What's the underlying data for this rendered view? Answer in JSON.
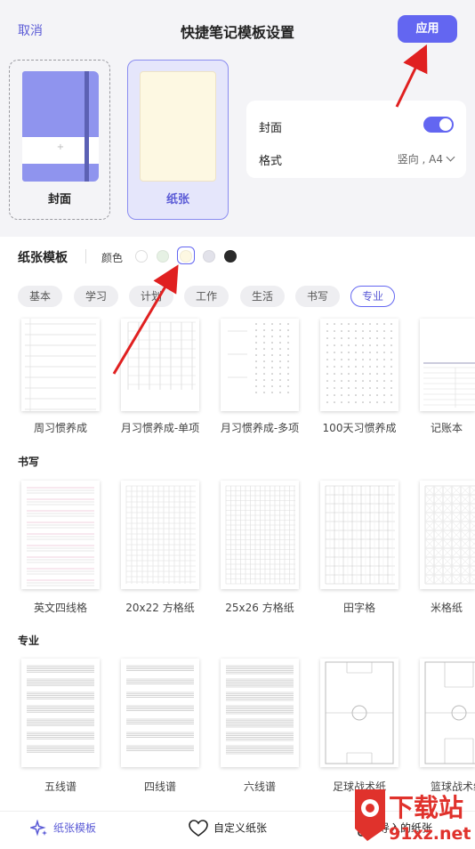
{
  "header": {
    "cancel": "取消",
    "title": "快捷笔记模板设置",
    "apply": "应用"
  },
  "cards": {
    "cover_label": "封面",
    "paper_label": "纸张",
    "cover_plus": "+"
  },
  "settings": {
    "cover_label": "封面",
    "cover_enabled": true,
    "format_label": "格式",
    "format_value": "竖向 , A4"
  },
  "template_bar": {
    "title": "纸张模板",
    "color_label": "颜色"
  },
  "colors": [
    "#ffffff",
    "#e6f1e4",
    "#fdf8e2",
    "#e2e2ea",
    "#2a2a2a"
  ],
  "selected_color_index": 2,
  "accent": "#6366f1",
  "tabs": [
    {
      "label": "基本",
      "active": false
    },
    {
      "label": "学习",
      "active": false
    },
    {
      "label": "计划",
      "active": false
    },
    {
      "label": "工作",
      "active": false
    },
    {
      "label": "生活",
      "active": false
    },
    {
      "label": "书写",
      "active": false
    },
    {
      "label": "专业",
      "active": true
    }
  ],
  "rows": [
    {
      "items": [
        "周习惯养成",
        "月习惯养成-单项",
        "月习惯养成-多项",
        "100天习惯养成",
        "记账本"
      ]
    },
    {
      "title": "书写",
      "items": [
        "英文四线格",
        "20x22 方格纸",
        "25x26 方格纸",
        "田字格",
        "米格纸"
      ]
    },
    {
      "title": "专业",
      "items": [
        "五线谱",
        "四线谱",
        "六线谱",
        "足球战术纸",
        "篮球战术纸"
      ]
    }
  ],
  "bottom_nav": [
    {
      "label": "纸张模板",
      "active": true
    },
    {
      "label": "自定义纸张",
      "active": false
    },
    {
      "label": "导入的纸张",
      "active": false
    }
  ],
  "watermark": {
    "text1": "下载站",
    "text2": "91xz.net"
  }
}
